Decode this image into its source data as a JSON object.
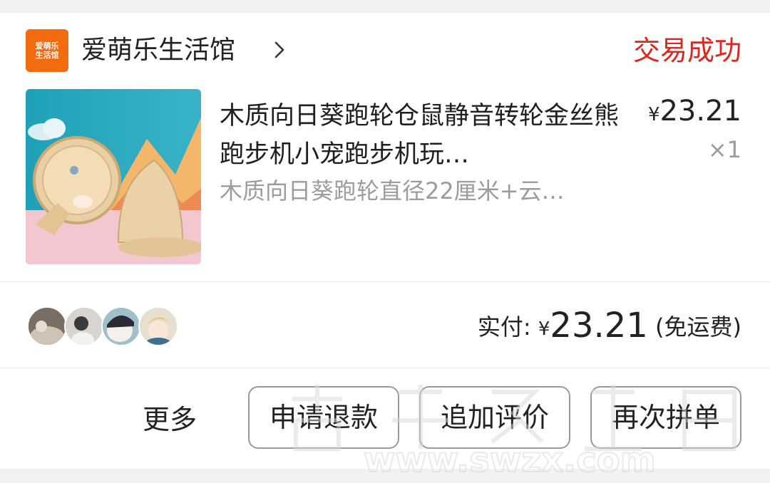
{
  "shop": {
    "logo_text": "爱萌乐生活馆",
    "name": "爱萌乐生活馆",
    "chevron_icon": "chevron-right-icon"
  },
  "order": {
    "status": "交易成功",
    "status_color": "#e0251b"
  },
  "product": {
    "title": "木质向日葵跑轮仓鼠静音转轮金丝熊跑步机小宠跑步机玩…",
    "spec": "木质向日葵跑轮直径22厘米+云…",
    "price_symbol": "¥",
    "price": "23.21",
    "quantity": "×1"
  },
  "payment": {
    "label": "实付:",
    "symbol": "¥",
    "amount": "23.21",
    "shipping_note": "(免运费)"
  },
  "avatars": [
    "buyer-avatar-1",
    "buyer-avatar-2",
    "buyer-avatar-3",
    "buyer-avatar-4"
  ],
  "actions": {
    "more": "更多",
    "refund": "申请退款",
    "review": "追加评价",
    "rebuy": "再次拼单"
  },
  "watermark": {
    "url_text": "www.swzx.com"
  },
  "colors": {
    "accent_red": "#e0251b",
    "logo_orange": "#f26b0f"
  }
}
